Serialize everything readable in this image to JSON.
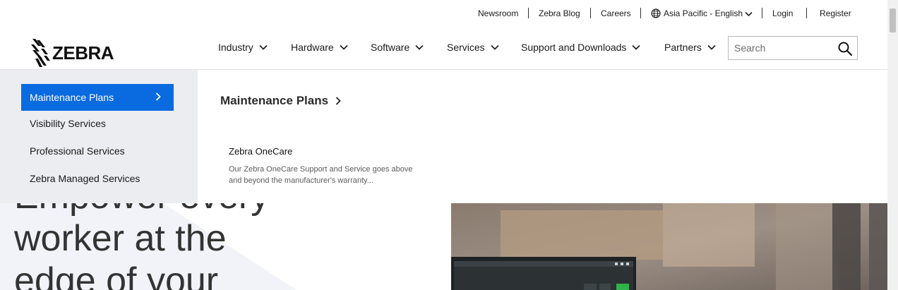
{
  "utility": {
    "newsroom": "Newsroom",
    "blog": "Zebra Blog",
    "careers": "Careers",
    "region": "Asia Pacific - English",
    "login": "Login",
    "register": "Register"
  },
  "logo": {
    "text": "ZEBRA"
  },
  "nav": {
    "industry": "Industry",
    "hardware": "Hardware",
    "software": "Software",
    "services": "Services",
    "support": "Support and Downloads",
    "partners": "Partners"
  },
  "search": {
    "placeholder": "Search"
  },
  "mega_menu": {
    "items": [
      {
        "label": "Maintenance Plans",
        "active": true
      },
      {
        "label": "Visibility Services",
        "active": false
      },
      {
        "label": "Professional Services",
        "active": false
      },
      {
        "label": "Zebra Managed Services",
        "active": false
      }
    ],
    "panel": {
      "title": "Maintenance Plans",
      "card_title": "Zebra OneCare",
      "card_desc": "Our Zebra OneCare Support and Service goes above and beyond the manufacturer's warranty..."
    }
  },
  "hero": {
    "line1": "Empower every",
    "line2": "worker at the",
    "line3": "edge of your"
  },
  "colors": {
    "accent": "#0a6be0",
    "menu_bg": "#ecedf0",
    "hero_shape": "#f1f3f8",
    "screen_accent": "#2fb34a"
  }
}
